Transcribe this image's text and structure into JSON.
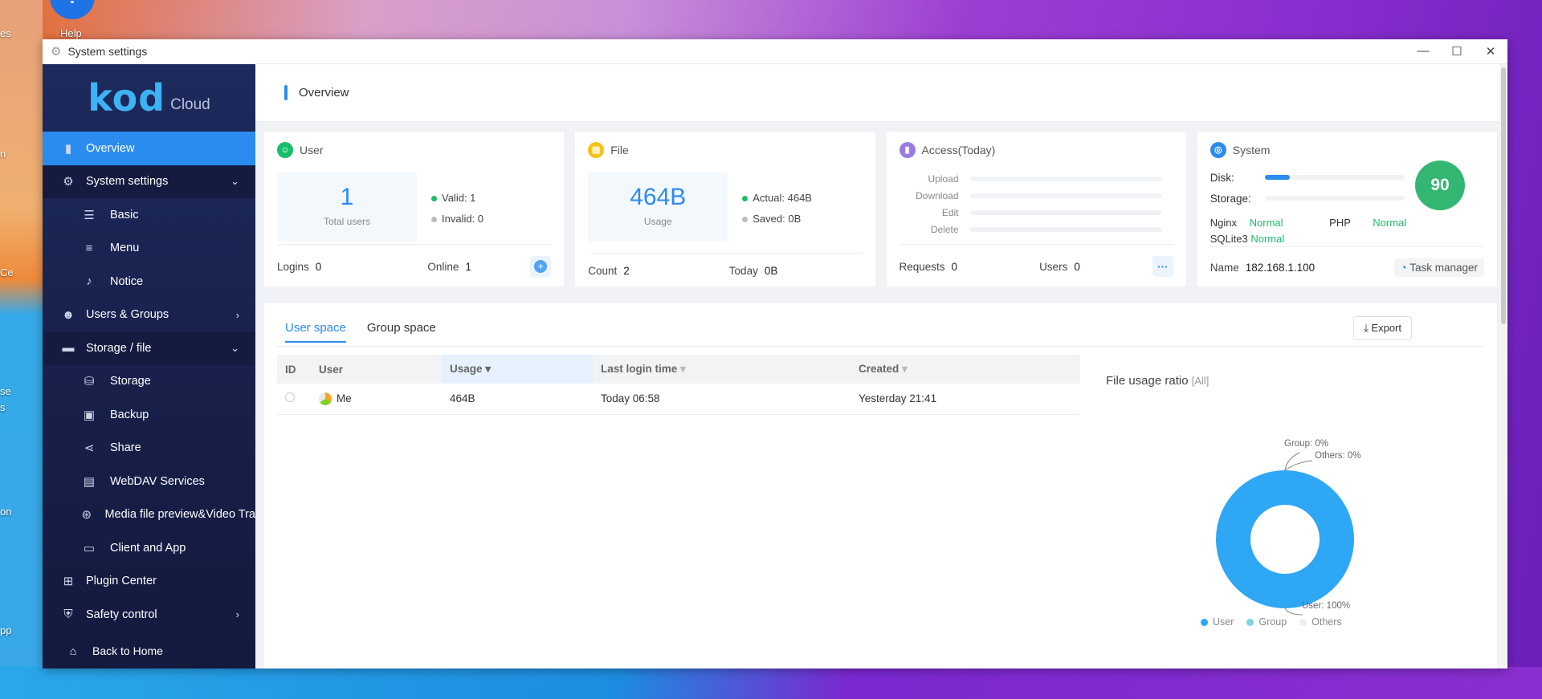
{
  "desktop": {
    "help_label": "Help",
    "left_icons": [
      "es",
      "n",
      "Ce",
      "se",
      "s",
      "on",
      "pp"
    ]
  },
  "window": {
    "title": "System settings",
    "controls": {
      "minimize": "—",
      "maximize": "☐",
      "close": "✕"
    }
  },
  "sidebar": {
    "logo_main": "kod",
    "logo_sub": "Cloud",
    "items": [
      {
        "label": "Overview",
        "icon": "chart-bar-icon",
        "glyph": "▮"
      },
      {
        "label": "System settings",
        "icon": "gear-icon",
        "glyph": "⚙"
      },
      {
        "label": "Basic",
        "icon": "sliders-icon",
        "glyph": "☰"
      },
      {
        "label": "Menu",
        "icon": "menu-icon",
        "glyph": "≡"
      },
      {
        "label": "Notice",
        "icon": "bell-icon",
        "glyph": "♪"
      },
      {
        "label": "Users & Groups",
        "icon": "users-icon",
        "glyph": "👥"
      },
      {
        "label": "Storage / file",
        "icon": "folder-icon",
        "glyph": "▬"
      },
      {
        "label": "Storage",
        "icon": "database-icon",
        "glyph": "⛁"
      },
      {
        "label": "Backup",
        "icon": "backup-icon",
        "glyph": "▣"
      },
      {
        "label": "Share",
        "icon": "share-icon",
        "glyph": "⋖"
      },
      {
        "label": "WebDAV Services",
        "icon": "webdav-icon",
        "glyph": "▤"
      },
      {
        "label": "Media file preview&Video Tra",
        "icon": "film-icon",
        "glyph": "⊛"
      },
      {
        "label": "Client and App",
        "icon": "monitor-icon",
        "glyph": "▭"
      },
      {
        "label": "Plugin Center",
        "icon": "plugin-icon",
        "glyph": "⊞"
      },
      {
        "label": "Safety control",
        "icon": "shield-icon",
        "glyph": "⛨"
      }
    ],
    "back_home": "Back to Home"
  },
  "header": {
    "title": "Overview"
  },
  "cards": {
    "user": {
      "title": "User",
      "big_value": "1",
      "big_label": "Total users",
      "valid": "Valid: 1",
      "invalid": "Invalid: 0",
      "logins_label": "Logins",
      "logins_value": "0",
      "online_label": "Online",
      "online_value": "1"
    },
    "file": {
      "title": "File",
      "big_value": "464B",
      "big_label": "Usage",
      "actual": "Actual: 464B",
      "saved": "Saved: 0B",
      "count_label": "Count",
      "count_value": "2",
      "today_label": "Today",
      "today_value": "0B"
    },
    "access": {
      "title": "Access(Today)",
      "rows": [
        "Upload",
        "Download",
        "Edit",
        "Delete"
      ],
      "requests_label": "Requests",
      "requests_value": "0",
      "users_label": "Users",
      "users_value": "0",
      "more": "···"
    },
    "system": {
      "title": "System",
      "disk_label": "Disk:",
      "disk_usage": 0.18,
      "storage_label": "Storage:",
      "storage_usage": 0,
      "score": "90",
      "nginx_label": "Nginx",
      "nginx_status": "Normal",
      "php_label": "PHP",
      "php_status": "Normal",
      "sqlite_label": "SQLite3",
      "sqlite_status": "Normal",
      "name_label": "Name",
      "name_value": "182.168.1.100",
      "task_button": "Task manager"
    }
  },
  "panel": {
    "tabs": [
      "User space",
      "Group space"
    ],
    "export_label": "Export",
    "columns": [
      "ID",
      "User",
      "Usage",
      "Last login time",
      "Created"
    ],
    "rows": [
      {
        "id": "",
        "user": "Me",
        "usage": "464B",
        "last_login": "Today 06:58",
        "created": "Yesterday 21:41"
      }
    ],
    "ratio_title": "File usage ratio",
    "ratio_filter": "[All]"
  },
  "chart_data": {
    "type": "pie",
    "title": "File usage ratio",
    "categories": [
      "User",
      "Group",
      "Others"
    ],
    "values": [
      100,
      0,
      0
    ],
    "labels": [
      "User: 100%",
      "Group: 0%",
      "Others: 0%"
    ],
    "legend": "bottom",
    "colors": [
      "#2ea7f5",
      "#7fd3e0",
      "#eeeeee"
    ]
  }
}
